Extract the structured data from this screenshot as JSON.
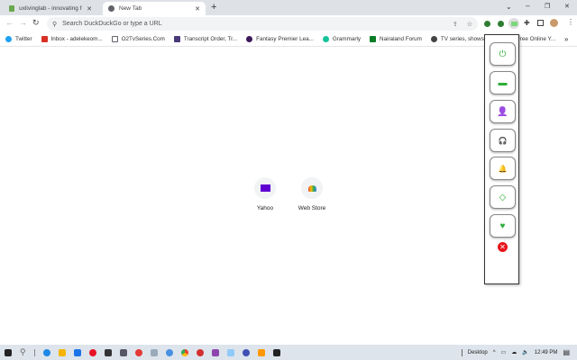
{
  "tabs": [
    {
      "title": "uxlivinglab - innovating from pe...",
      "active": false
    },
    {
      "title": "New Tab",
      "active": true
    }
  ],
  "new_tab_symbol": "+",
  "window_controls": {
    "dropdown": "⌄",
    "minimize": "–",
    "restore": "❐",
    "close": "✕"
  },
  "omnibox": {
    "placeholder": "Search DuckDuckGo or type a URL"
  },
  "bookmarks": [
    {
      "label": "Twitter",
      "color": "#1da1f2"
    },
    {
      "label": "Inbox - adelekeom...",
      "color": "#d93025"
    },
    {
      "label": "O2TvSeries.Com",
      "color": "#5f6368"
    },
    {
      "label": "Transcript Order, Tr...",
      "color": "#4a3a7a"
    },
    {
      "label": "Fantasy Premier Lea...",
      "color": "#3d195b"
    },
    {
      "label": "Grammarly",
      "color": "#15c39a"
    },
    {
      "label": "Nairaland Forum",
      "color": "#0a7d26"
    },
    {
      "label": "TV series, shows/Ca...",
      "color": "#444"
    },
    {
      "label": "Free Online Y...",
      "color": "#7cc60e"
    }
  ],
  "bookmarks_overflow": "»",
  "shortcuts": [
    {
      "label": "Yahoo",
      "icon": "yahoo-mail-icon",
      "color": "#6001d2"
    },
    {
      "label": "Web Store",
      "icon": "chrome-web-store-icon",
      "color": "#ea4335"
    }
  ],
  "popup": {
    "accent": "#2fae3a",
    "buttons": [
      {
        "icon": "power-icon",
        "glyph": "⏻"
      },
      {
        "icon": "credit-card-icon",
        "glyph": "▬"
      },
      {
        "icon": "user-icon",
        "glyph": "👤"
      },
      {
        "icon": "headset-icon",
        "glyph": "🎧"
      },
      {
        "icon": "bell-icon",
        "glyph": "🔔"
      },
      {
        "icon": "diamond-icon",
        "glyph": "◇"
      },
      {
        "icon": "hand-heart-icon",
        "glyph": "♥"
      }
    ],
    "close_glyph": "✕"
  },
  "taskbar": {
    "desktop_label": "Desktop",
    "time": "12:49 PM"
  }
}
